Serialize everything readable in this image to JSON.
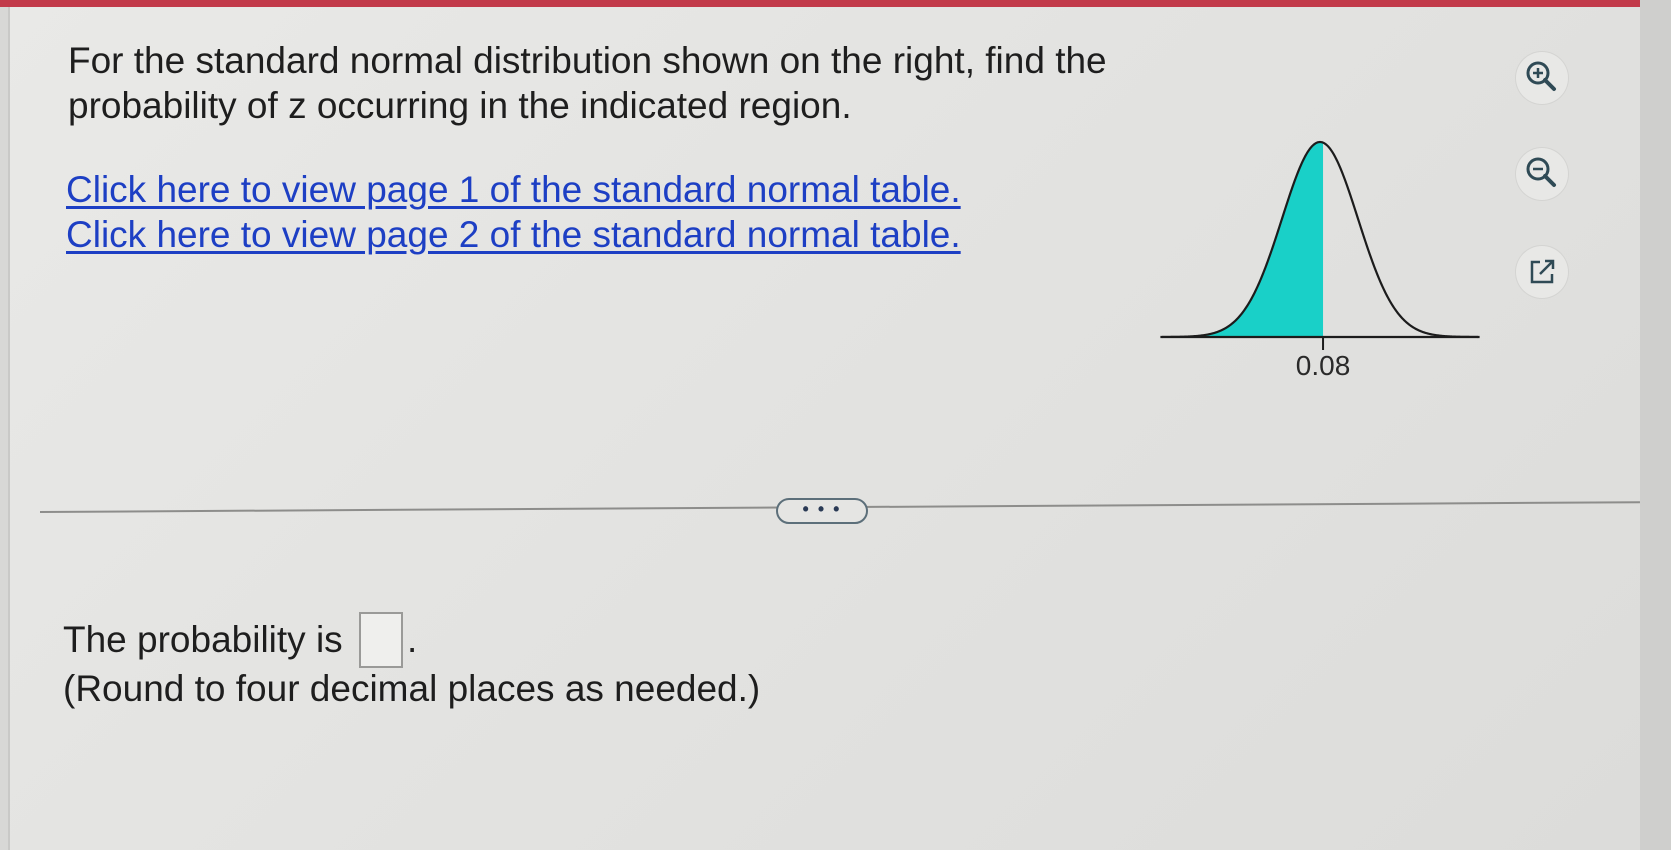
{
  "question": {
    "text": "For the standard normal distribution shown on the right, find the probability of z occurring in the indicated region."
  },
  "links": [
    {
      "label": "Click here to view page 1 of the standard normal table."
    },
    {
      "label": "Click here to view page 2 of the standard normal table."
    }
  ],
  "graph": {
    "z_value": 0.08,
    "z_label": "0.08",
    "shaded_region": "left",
    "shade_color": "#19d0c8"
  },
  "toolbar": {
    "icons": [
      "zoom-in-icon",
      "zoom-out-icon",
      "popout-icon"
    ]
  },
  "divider": {
    "more_label": "• • •"
  },
  "answer": {
    "prefix": "The probability is",
    "suffix": ".",
    "value": "",
    "hint": "(Round to four decimal places as needed.)"
  },
  "colors": {
    "link": "#1d3fc4",
    "accent_strip": "#c23a4a"
  }
}
